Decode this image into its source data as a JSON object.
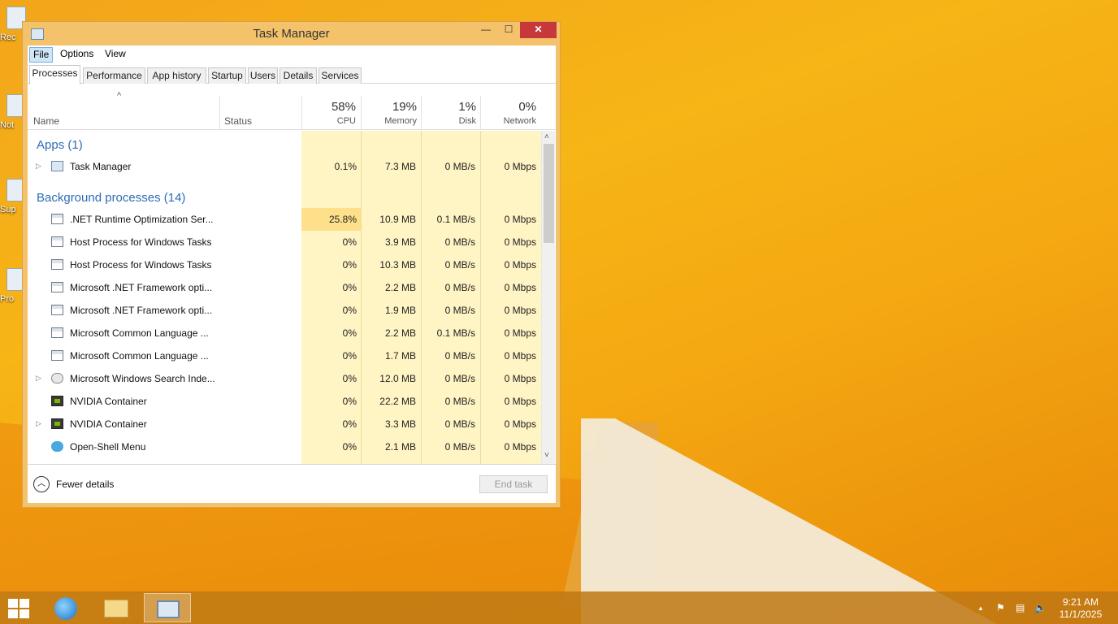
{
  "desktop": {
    "icons": [
      {
        "label": "Rec"
      },
      {
        "label": "Not"
      },
      {
        "label": "Sup"
      },
      {
        "label": "Pro"
      }
    ]
  },
  "window": {
    "title": "Task Manager",
    "controls": {
      "minimize": "—",
      "maximize": "☐",
      "close": "✕"
    }
  },
  "menu": {
    "items": [
      "File",
      "Options",
      "View"
    ]
  },
  "tabs": [
    "Processes",
    "Performance",
    "App history",
    "Startup",
    "Users",
    "Details",
    "Services"
  ],
  "columns": {
    "sort_arrow": "^",
    "name": "Name",
    "status": "Status",
    "cpu": {
      "pct": "58%",
      "label": "CPU"
    },
    "memory": {
      "pct": "19%",
      "label": "Memory"
    },
    "disk": {
      "pct": "1%",
      "label": "Disk"
    },
    "network": {
      "pct": "0%",
      "label": "Network"
    }
  },
  "groups": {
    "apps": "Apps (1)",
    "background": "Background processes (14)"
  },
  "apps": [
    {
      "name": "Task Manager",
      "cpu": "0.1%",
      "memory": "7.3 MB",
      "disk": "0 MB/s",
      "network": "0 Mbps"
    }
  ],
  "processes": [
    {
      "name": ".NET Runtime Optimization Ser...",
      "cpu": "25.8%",
      "memory": "10.9 MB",
      "disk": "0.1 MB/s",
      "network": "0 Mbps"
    },
    {
      "name": "Host Process for Windows Tasks",
      "cpu": "0%",
      "memory": "3.9 MB",
      "disk": "0 MB/s",
      "network": "0 Mbps"
    },
    {
      "name": "Host Process for Windows Tasks",
      "cpu": "0%",
      "memory": "10.3 MB",
      "disk": "0 MB/s",
      "network": "0 Mbps"
    },
    {
      "name": "Microsoft .NET Framework opti...",
      "cpu": "0%",
      "memory": "2.2 MB",
      "disk": "0 MB/s",
      "network": "0 Mbps"
    },
    {
      "name": "Microsoft .NET Framework opti...",
      "cpu": "0%",
      "memory": "1.9 MB",
      "disk": "0 MB/s",
      "network": "0 Mbps"
    },
    {
      "name": "Microsoft Common Language ...",
      "cpu": "0%",
      "memory": "2.2 MB",
      "disk": "0.1 MB/s",
      "network": "0 Mbps"
    },
    {
      "name": "Microsoft Common Language ...",
      "cpu": "0%",
      "memory": "1.7 MB",
      "disk": "0 MB/s",
      "network": "0 Mbps"
    },
    {
      "name": "Microsoft Windows Search Inde...",
      "cpu": "0%",
      "memory": "12.0 MB",
      "disk": "0 MB/s",
      "network": "0 Mbps"
    },
    {
      "name": "NVIDIA Container",
      "cpu": "0%",
      "memory": "22.2 MB",
      "disk": "0 MB/s",
      "network": "0 Mbps"
    },
    {
      "name": "NVIDIA Container",
      "cpu": "0%",
      "memory": "3.3 MB",
      "disk": "0 MB/s",
      "network": "0 Mbps"
    },
    {
      "name": "Open-Shell Menu",
      "cpu": "0%",
      "memory": "2.1 MB",
      "disk": "0 MB/s",
      "network": "0 Mbps"
    }
  ],
  "footer": {
    "fewer_details": "Fewer details",
    "end_task": "End task"
  },
  "taskbar": {
    "clock_time": "9:21 AM",
    "clock_date": "11/1/2025",
    "tray": {
      "chevron": "▲",
      "flag": "⚑",
      "network": "▤",
      "volume": "🔈"
    }
  },
  "colors": {
    "accent": "#2d6bb5",
    "heat_light": "#fff4c4",
    "heat_strong": "#ffe08a",
    "close": "#c7383a"
  }
}
